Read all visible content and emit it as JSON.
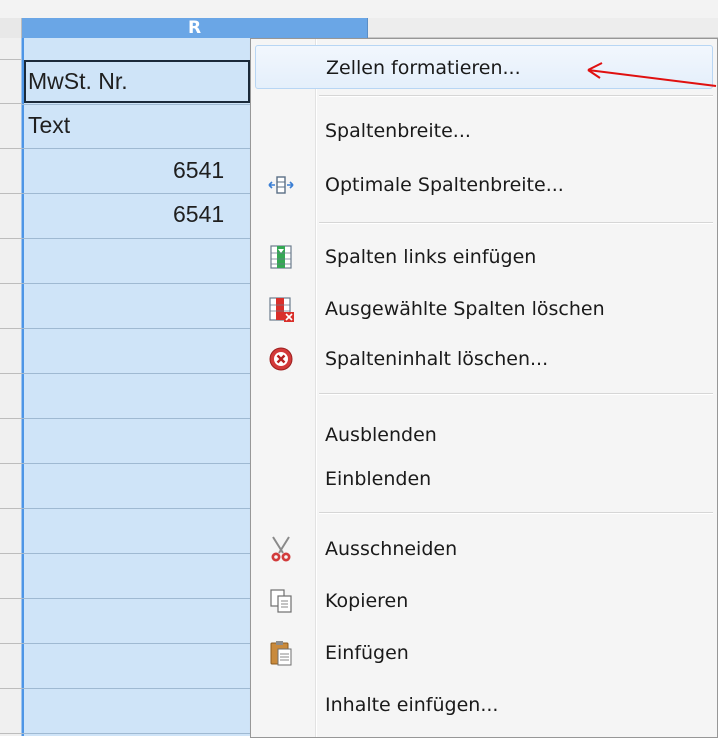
{
  "sheet": {
    "column_header": "R",
    "cells": [
      "MwSt. Nr.",
      "Text",
      "6541",
      "6541"
    ]
  },
  "context_menu": {
    "items": [
      {
        "label": "Zellen formatieren...",
        "icon": ""
      },
      {
        "label": "Spaltenbreite...",
        "icon": ""
      },
      {
        "label": "Optimale Spaltenbreite...",
        "icon": "optimal-width-icon"
      },
      {
        "label": "Spalten links einfügen",
        "icon": "insert-column-icon"
      },
      {
        "label": "Ausgewählte Spalten löschen",
        "icon": "delete-column-icon"
      },
      {
        "label": "Spalteninhalt löschen...",
        "icon": "clear-content-icon"
      },
      {
        "label": "Ausblenden",
        "icon": ""
      },
      {
        "label": "Einblenden",
        "icon": ""
      },
      {
        "label": "Ausschneiden",
        "icon": "scissors-icon"
      },
      {
        "label": "Kopieren",
        "icon": "copy-icon"
      },
      {
        "label": "Einfügen",
        "icon": "paste-icon"
      },
      {
        "label": "Inhalte einfügen...",
        "icon": ""
      }
    ]
  },
  "colors": {
    "selection": "#cfe4f8",
    "column_header": "#6aa6e6",
    "annotation_arrow": "#e01010"
  }
}
